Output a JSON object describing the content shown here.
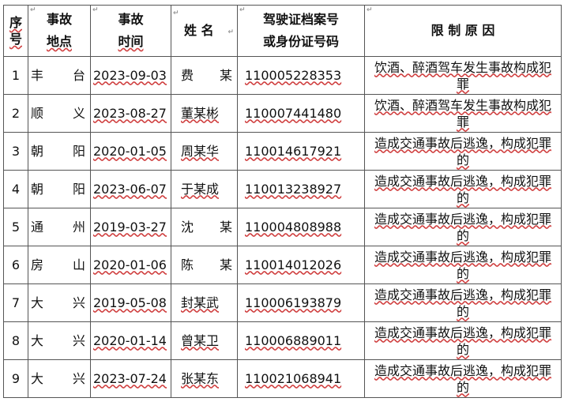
{
  "header": {
    "seq": "序号",
    "place_line1": "事故",
    "place_line2": "地点",
    "time_line1": "事故",
    "time_line2": "时间",
    "name": "姓 名",
    "license_line1": "驾驶证档案号",
    "license_line2": "或身份证号码",
    "reason": "限 制 原 因",
    "paragraph_mark": "↵"
  },
  "rows": [
    {
      "seq": "1",
      "place": [
        "丰",
        "台"
      ],
      "date": "2023-09-03",
      "name": [
        "费",
        "某"
      ],
      "license": "110005228353",
      "reason": "饮酒、醉酒驾车发生事故构成犯罪"
    },
    {
      "seq": "2",
      "place": [
        "顺",
        "义"
      ],
      "date": "2023-08-27",
      "name": [
        "董某彬"
      ],
      "license": "110007441480",
      "reason": "饮酒、醉酒驾车发生事故构成犯罪"
    },
    {
      "seq": "3",
      "place": [
        "朝",
        "阳"
      ],
      "date": "2020-01-05",
      "name": [
        "周某华"
      ],
      "license": "110014617921",
      "reason": "造成交通事故后逃逸，构成犯罪的"
    },
    {
      "seq": "4",
      "place": [
        "朝",
        "阳"
      ],
      "date": "2023-06-07",
      "name": [
        "于某成"
      ],
      "license": "110013238927",
      "reason": "造成交通事故后逃逸，构成犯罪的"
    },
    {
      "seq": "5",
      "place": [
        "通",
        "州"
      ],
      "date": "2019-03-27",
      "name": [
        "沈",
        "某"
      ],
      "license": "110004808988",
      "reason": "造成交通事故后逃逸，构成犯罪的"
    },
    {
      "seq": "6",
      "place": [
        "房",
        "山"
      ],
      "date": "2020-01-06",
      "name": [
        "陈",
        "某"
      ],
      "license": "110014012026",
      "reason": "造成交通事故后逃逸，构成犯罪的"
    },
    {
      "seq": "7",
      "place": [
        "大",
        "兴"
      ],
      "date": "2019-05-08",
      "name": [
        "封某武"
      ],
      "license": "110006193879",
      "reason": "造成交通事故后逃逸，构成犯罪的"
    },
    {
      "seq": "8",
      "place": [
        "大",
        "兴"
      ],
      "date": "2020-01-14",
      "name": [
        "曾某卫"
      ],
      "license": "110006889011",
      "reason": "造成交通事故后逃逸，构成犯罪的"
    },
    {
      "seq": "9",
      "place": [
        "大",
        "兴"
      ],
      "date": "2023-07-24",
      "name": [
        "张某东"
      ],
      "license": "110021068941",
      "reason": "造成交通事故后逃逸，构成犯罪的"
    }
  ]
}
